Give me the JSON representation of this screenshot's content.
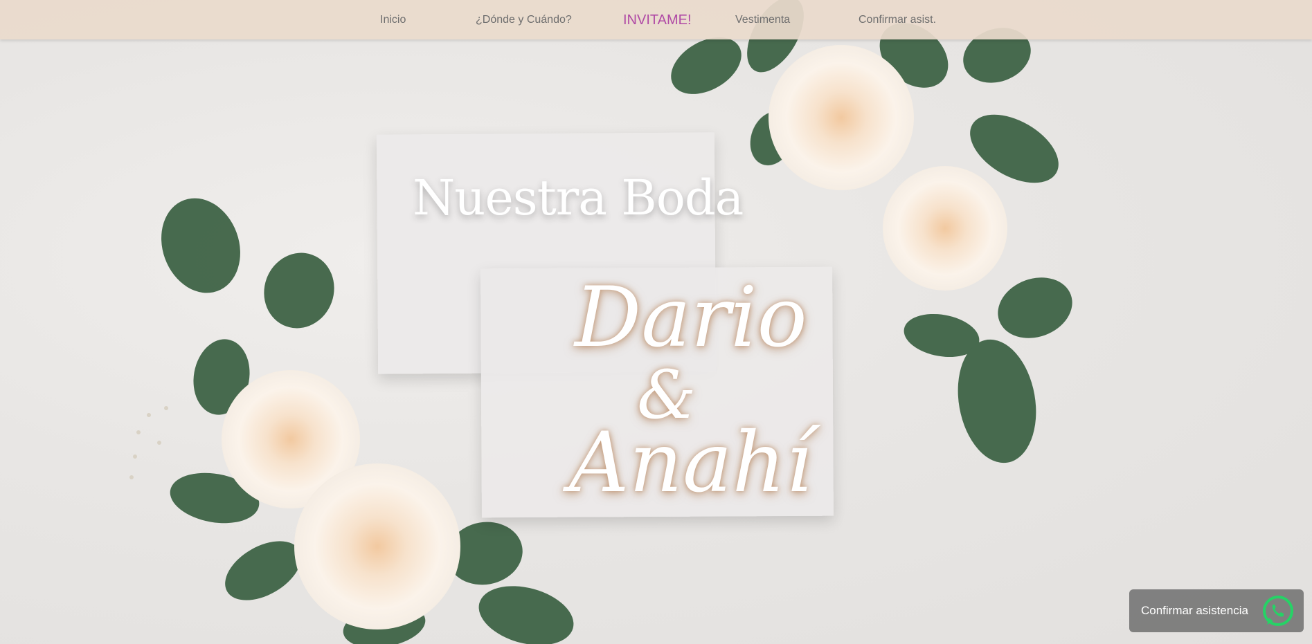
{
  "nav": {
    "items": [
      {
        "label": "Inicio"
      },
      {
        "label": "¿Dónde y Cuándo?"
      },
      {
        "label": "INVITAME!"
      },
      {
        "label": "Vestimenta"
      },
      {
        "label": "Confirmar asist."
      }
    ],
    "active_color": "#b04aa5"
  },
  "hero": {
    "title": "Nuestra Boda",
    "name1": "Dario",
    "ampersand": "&",
    "name2": "Anahí"
  },
  "whatsapp": {
    "label": "Confirmar asistencia",
    "icon": "whatsapp-icon",
    "color": "#25d366"
  }
}
